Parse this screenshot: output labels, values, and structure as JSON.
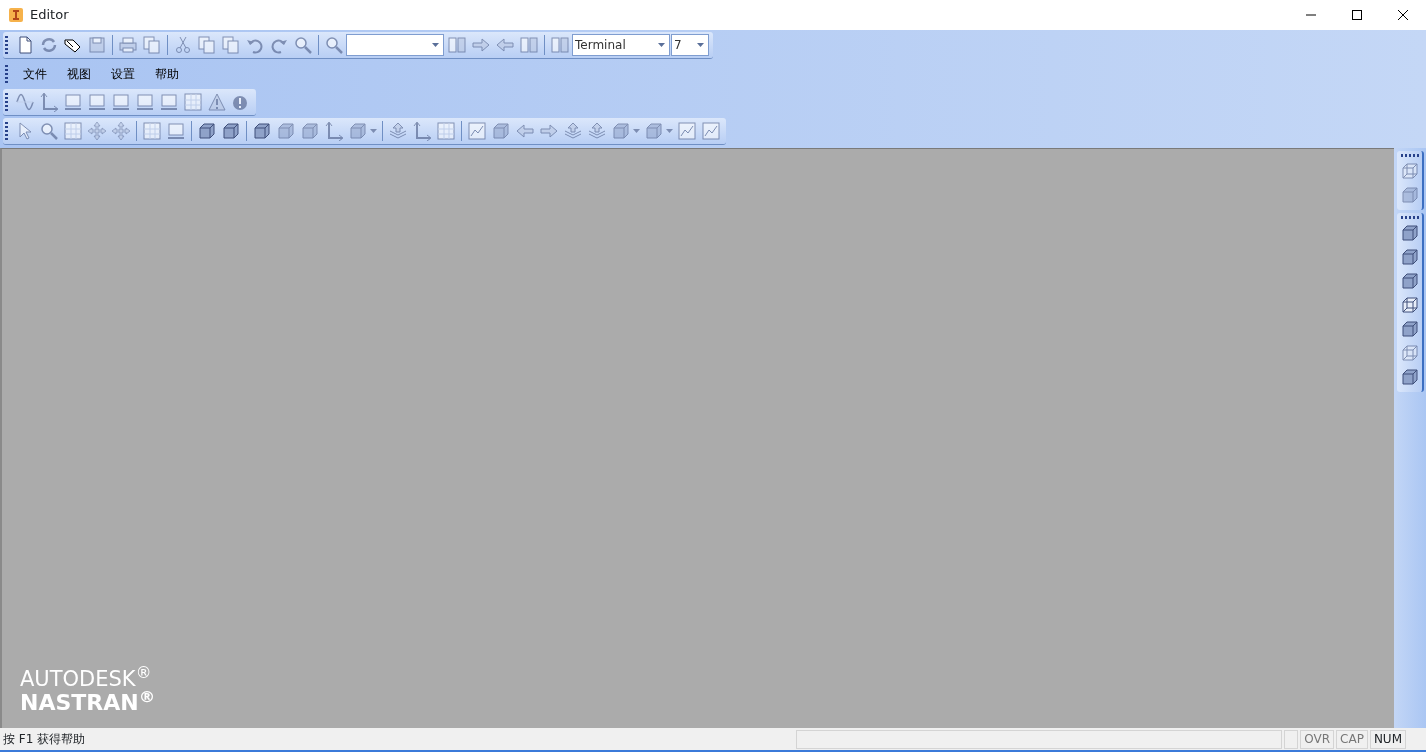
{
  "window": {
    "title": "Editor"
  },
  "toolbars": [
    {
      "items": [
        {
          "kind": "button",
          "disabled": false
        },
        {
          "kind": "button",
          "disabled": true
        },
        {
          "kind": "button",
          "disabled": false
        },
        {
          "kind": "button",
          "disabled": true
        },
        {
          "kind": "separator"
        },
        {
          "kind": "button",
          "disabled": true
        },
        {
          "kind": "button",
          "disabled": true
        },
        {
          "kind": "separator"
        },
        {
          "kind": "button",
          "disabled": true
        },
        {
          "kind": "button",
          "disabled": true
        },
        {
          "kind": "button",
          "disabled": true
        },
        {
          "kind": "button",
          "disabled": true
        },
        {
          "kind": "button",
          "disabled": true
        },
        {
          "kind": "button",
          "disabled": true
        },
        {
          "kind": "separator"
        },
        {
          "kind": "button",
          "disabled": true
        },
        {
          "kind": "combo"
        },
        {
          "kind": "button",
          "disabled": true
        },
        {
          "kind": "button",
          "disabled": true
        },
        {
          "kind": "button",
          "disabled": true
        },
        {
          "kind": "button",
          "disabled": true
        },
        {
          "kind": "separator"
        },
        {
          "kind": "button",
          "disabled": true
        },
        {
          "kind": "combo",
          "value": "Terminal"
        },
        {
          "kind": "combo",
          "value": "7"
        }
      ]
    },
    {
      "menu": [
        "文件",
        "视图",
        "设置",
        "帮助"
      ]
    },
    {
      "items": [
        {
          "kind": "button",
          "disabled": true
        },
        {
          "kind": "button",
          "disabled": true
        },
        {
          "kind": "button",
          "disabled": true
        },
        {
          "kind": "button",
          "disabled": true
        },
        {
          "kind": "button",
          "disabled": true
        },
        {
          "kind": "button",
          "disabled": true
        },
        {
          "kind": "button",
          "disabled": true
        },
        {
          "kind": "button",
          "disabled": true
        },
        {
          "kind": "button",
          "disabled": true
        },
        {
          "kind": "button",
          "disabled": true
        }
      ]
    },
    {
      "items": [
        {
          "kind": "button",
          "disabled": true
        },
        {
          "kind": "button",
          "disabled": true
        },
        {
          "kind": "button",
          "disabled": true
        },
        {
          "kind": "button",
          "disabled": true
        },
        {
          "kind": "button",
          "disabled": true
        },
        {
          "kind": "separator"
        },
        {
          "kind": "button",
          "disabled": true
        },
        {
          "kind": "button",
          "disabled": true
        },
        {
          "kind": "separator"
        },
        {
          "kind": "button",
          "disabled": false
        },
        {
          "kind": "button",
          "disabled": false
        },
        {
          "kind": "separator"
        },
        {
          "kind": "button",
          "disabled": false
        },
        {
          "kind": "button",
          "disabled": true
        },
        {
          "kind": "button",
          "disabled": true
        },
        {
          "kind": "button",
          "disabled": true
        },
        {
          "kind": "dropdown",
          "disabled": true
        },
        {
          "kind": "separator"
        },
        {
          "kind": "button",
          "disabled": true
        },
        {
          "kind": "button",
          "disabled": true
        },
        {
          "kind": "button",
          "disabled": true
        },
        {
          "kind": "separator"
        },
        {
          "kind": "button",
          "disabled": true
        },
        {
          "kind": "button",
          "disabled": true
        },
        {
          "kind": "button",
          "disabled": true
        },
        {
          "kind": "button",
          "disabled": true
        },
        {
          "kind": "button",
          "disabled": true
        },
        {
          "kind": "button",
          "disabled": true
        },
        {
          "kind": "dropdown",
          "disabled": true
        },
        {
          "kind": "dropdown",
          "disabled": true
        },
        {
          "kind": "button",
          "disabled": true
        },
        {
          "kind": "button",
          "disabled": true
        }
      ]
    }
  ],
  "view_toolbars": [
    {
      "items": [
        {
          "disabled": true
        },
        {
          "disabled": true
        }
      ]
    },
    {
      "items": [
        {
          "disabled": false
        },
        {
          "disabled": false
        },
        {
          "disabled": false
        },
        {
          "disabled": false
        },
        {
          "disabled": false
        },
        {
          "disabled": true
        },
        {
          "disabled": false
        }
      ]
    }
  ],
  "logo": {
    "line_1": "AUTODESK$^{®}$",
    "line_2": "NASTRAN$^{®}$"
  },
  "status_bar": {
    "message": "按 F1 获得帮助",
    "indicators": [
      {
        "label": "OVR",
        "on": false
      },
      {
        "label": "CAP",
        "on": false
      },
      {
        "label": "NUM",
        "on": true
      }
    ]
  }
}
